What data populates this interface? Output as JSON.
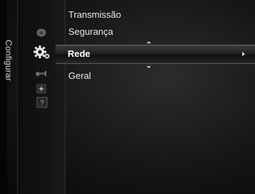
{
  "side_label": "Configurar",
  "menu": {
    "items_above": [
      "Transmissão",
      "Segurança"
    ],
    "selected": "Rede",
    "items_below": [
      "Geral"
    ]
  },
  "category_icons": [
    "channel-icon",
    "settings-gear-icon",
    "input-icon",
    "application-icon",
    "support-help-icon"
  ]
}
